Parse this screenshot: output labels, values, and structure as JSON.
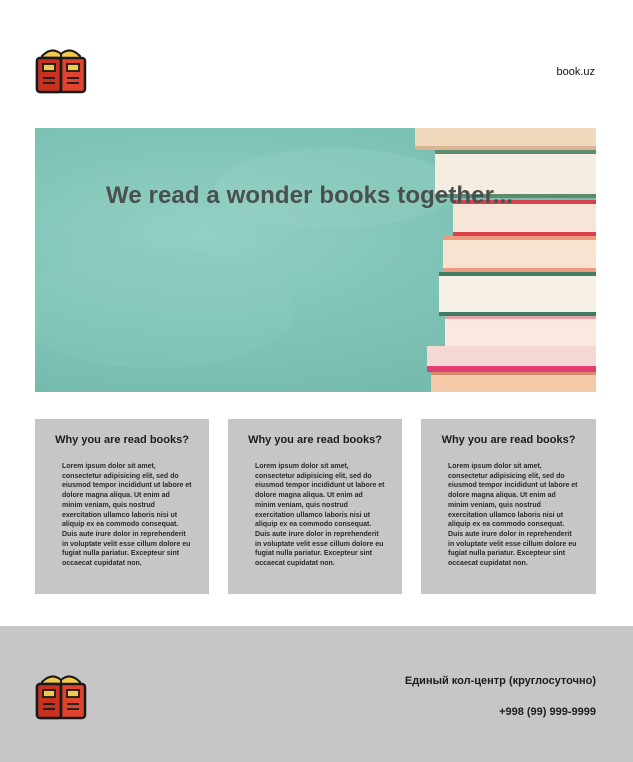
{
  "header": {
    "site_link": "book.uz",
    "logo_icon": "open-book-icon"
  },
  "hero": {
    "title": "We read a wonder books together..."
  },
  "cards": [
    {
      "title": "Why you are read books?",
      "text": "Lorem ipsum dolor sit amet, consectetur adipisicing elit, sed do eiusmod tempor incididunt ut labore et dolore magna aliqua. Ut enim ad minim veniam, quis nostrud exercitation ullamco laboris nisi ut aliquip ex ea commodo consequat. Duis aute irure dolor in reprehenderit in voluptate velit esse cillum dolore eu fugiat nulla pariatur. Excepteur sint occaecat cupidatat non."
    },
    {
      "title": "Why you are read books?",
      "text": "Lorem ipsum dolor sit amet, consectetur adipisicing elit, sed do eiusmod tempor incididunt ut labore et dolore magna aliqua. Ut enim ad minim veniam, quis nostrud exercitation ullamco laboris nisi ut aliquip ex ea commodo consequat. Duis aute irure dolor in reprehenderit in voluptate velit esse cillum dolore eu fugiat nulla pariatur. Excepteur sint occaecat cupidatat non."
    },
    {
      "title": "Why you are read books?",
      "text": "Lorem ipsum dolor sit amet, consectetur adipisicing elit, sed do eiusmod tempor incididunt ut labore et dolore magna aliqua. Ut enim ad minim veniam, quis nostrud exercitation ullamco laboris nisi ut aliquip ex ea commodo consequat. Duis aute irure dolor in reprehenderit in voluptate velit esse cillum dolore eu fugiat nulla pariatur. Excepteur sint occaecat cupidatat non."
    }
  ],
  "footer": {
    "callcenter": "Единый кол-центр (круглосуточно)",
    "phone": "+998 (99) 999-9999",
    "logo_icon": "open-book-icon"
  },
  "colors": {
    "card_bg": "#c6c6c6",
    "footer_bg": "#c6c6c6",
    "hero_bg": "#7fc4b6",
    "logo_red": "#e0442e"
  }
}
